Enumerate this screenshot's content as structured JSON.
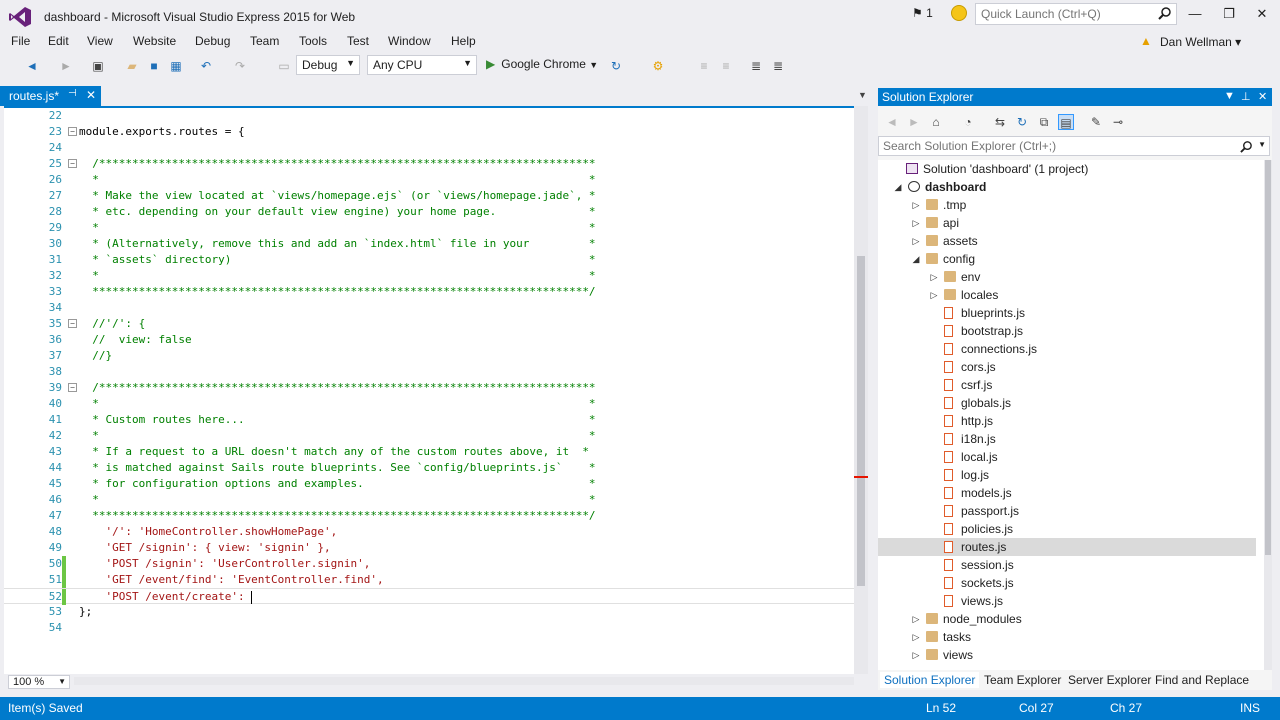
{
  "window": {
    "title": "dashboard - Microsoft Visual Studio Express 2015 for Web",
    "notification_count": "1",
    "quick_launch_placeholder": "Quick Launch (Ctrl+Q)",
    "controls": {
      "minimize": "—",
      "restore": "❐",
      "close": "✕"
    }
  },
  "menu": {
    "items": [
      "File",
      "Edit",
      "View",
      "Website",
      "Debug",
      "Team",
      "Tools",
      "Test",
      "Window",
      "Help"
    ],
    "user": "Dan Wellman"
  },
  "toolbar": {
    "config": "Debug",
    "platform": "Any CPU",
    "run_target": "Google Chrome"
  },
  "editor": {
    "tab_label": "routes.js*",
    "zoom": "100 %",
    "lines": [
      {
        "n": "22",
        "t": "",
        "c": "plain"
      },
      {
        "n": "23",
        "t": "module.exports.routes = {",
        "c": "plain",
        "fold": "−"
      },
      {
        "n": "24",
        "t": "",
        "c": "plain"
      },
      {
        "n": "25",
        "t": "  /***************************************************************************",
        "c": "comment",
        "fold": "−"
      },
      {
        "n": "26",
        "t": "  *                                                                          *",
        "c": "comment"
      },
      {
        "n": "27",
        "t": "  * Make the view located at `views/homepage.ejs` (or `views/homepage.jade`, *",
        "c": "comment"
      },
      {
        "n": "28",
        "t": "  * etc. depending on your default view engine) your home page.              *",
        "c": "comment"
      },
      {
        "n": "29",
        "t": "  *                                                                          *",
        "c": "comment"
      },
      {
        "n": "30",
        "t": "  * (Alternatively, remove this and add an `index.html` file in your         *",
        "c": "comment"
      },
      {
        "n": "31",
        "t": "  * `assets` directory)                                                      *",
        "c": "comment"
      },
      {
        "n": "32",
        "t": "  *                                                                          *",
        "c": "comment"
      },
      {
        "n": "33",
        "t": "  ***************************************************************************/",
        "c": "comment"
      },
      {
        "n": "34",
        "t": "",
        "c": "plain"
      },
      {
        "n": "35",
        "t": "  //'/': {",
        "c": "comment",
        "fold": "−"
      },
      {
        "n": "36",
        "t": "  //  view: false",
        "c": "comment"
      },
      {
        "n": "37",
        "t": "  //}",
        "c": "comment"
      },
      {
        "n": "38",
        "t": "",
        "c": "plain"
      },
      {
        "n": "39",
        "t": "  /***************************************************************************",
        "c": "comment",
        "fold": "−"
      },
      {
        "n": "40",
        "t": "  *                                                                          *",
        "c": "comment"
      },
      {
        "n": "41",
        "t": "  * Custom routes here...                                                    *",
        "c": "comment"
      },
      {
        "n": "42",
        "t": "  *                                                                          *",
        "c": "comment"
      },
      {
        "n": "43",
        "t": "  * If a request to a URL doesn't match any of the custom routes above, it  *",
        "c": "comment"
      },
      {
        "n": "44",
        "t": "  * is matched against Sails route blueprints. See `config/blueprints.js`    *",
        "c": "comment"
      },
      {
        "n": "45",
        "t": "  * for configuration options and examples.                                  *",
        "c": "comment"
      },
      {
        "n": "46",
        "t": "  *                                                                          *",
        "c": "comment"
      },
      {
        "n": "47",
        "t": "  ***************************************************************************/",
        "c": "comment"
      },
      {
        "n": "48",
        "t": "    '/': 'HomeController.showHomePage',",
        "c": "string"
      },
      {
        "n": "49",
        "t": "    'GET /signin': { view: 'signin' },",
        "c": "string"
      },
      {
        "n": "50",
        "t": "    'POST /signin': 'UserController.signin',",
        "c": "string",
        "changed": true
      },
      {
        "n": "51",
        "t": "    'GET /event/find': 'EventController.find',",
        "c": "string",
        "changed": true
      },
      {
        "n": "52",
        "t": "    'POST /event/create': ",
        "c": "string",
        "changed": true,
        "current": true
      },
      {
        "n": "53",
        "t": "};",
        "c": "plain"
      },
      {
        "n": "54",
        "t": "",
        "c": "plain"
      }
    ]
  },
  "solution_explorer": {
    "title": "Solution Explorer",
    "search_placeholder": "Search Solution Explorer (Ctrl+;)",
    "tree": [
      {
        "label": "Solution 'dashboard' (1 project)",
        "depth": 0,
        "type": "solution",
        "tw": ""
      },
      {
        "label": "dashboard",
        "depth": 1,
        "type": "project",
        "tw": "◢",
        "bold": true
      },
      {
        "label": ".tmp",
        "depth": 2,
        "type": "folder",
        "tw": "▷"
      },
      {
        "label": "api",
        "depth": 2,
        "type": "folder",
        "tw": "▷"
      },
      {
        "label": "assets",
        "depth": 2,
        "type": "folder",
        "tw": "▷"
      },
      {
        "label": "config",
        "depth": 2,
        "type": "folder-open",
        "tw": "◢"
      },
      {
        "label": "env",
        "depth": 3,
        "type": "folder",
        "tw": "▷"
      },
      {
        "label": "locales",
        "depth": 3,
        "type": "folder",
        "tw": "▷"
      },
      {
        "label": "blueprints.js",
        "depth": 3,
        "type": "js",
        "tw": ""
      },
      {
        "label": "bootstrap.js",
        "depth": 3,
        "type": "js",
        "tw": ""
      },
      {
        "label": "connections.js",
        "depth": 3,
        "type": "js",
        "tw": ""
      },
      {
        "label": "cors.js",
        "depth": 3,
        "type": "js",
        "tw": ""
      },
      {
        "label": "csrf.js",
        "depth": 3,
        "type": "js",
        "tw": ""
      },
      {
        "label": "globals.js",
        "depth": 3,
        "type": "js",
        "tw": ""
      },
      {
        "label": "http.js",
        "depth": 3,
        "type": "js",
        "tw": ""
      },
      {
        "label": "i18n.js",
        "depth": 3,
        "type": "js",
        "tw": ""
      },
      {
        "label": "local.js",
        "depth": 3,
        "type": "js",
        "tw": ""
      },
      {
        "label": "log.js",
        "depth": 3,
        "type": "js",
        "tw": ""
      },
      {
        "label": "models.js",
        "depth": 3,
        "type": "js",
        "tw": ""
      },
      {
        "label": "passport.js",
        "depth": 3,
        "type": "js",
        "tw": ""
      },
      {
        "label": "policies.js",
        "depth": 3,
        "type": "js",
        "tw": ""
      },
      {
        "label": "routes.js",
        "depth": 3,
        "type": "js",
        "tw": "",
        "selected": true
      },
      {
        "label": "session.js",
        "depth": 3,
        "type": "js",
        "tw": ""
      },
      {
        "label": "sockets.js",
        "depth": 3,
        "type": "js",
        "tw": ""
      },
      {
        "label": "views.js",
        "depth": 3,
        "type": "js",
        "tw": ""
      },
      {
        "label": "node_modules",
        "depth": 2,
        "type": "folder",
        "tw": "▷"
      },
      {
        "label": "tasks",
        "depth": 2,
        "type": "folder",
        "tw": "▷"
      },
      {
        "label": "views",
        "depth": 2,
        "type": "folder",
        "tw": "▷"
      }
    ],
    "tabs": [
      "Solution Explorer",
      "Team Explorer",
      "Server Explorer",
      "Find and Replace"
    ]
  },
  "status": {
    "message": "Item(s) Saved",
    "line": "Ln 52",
    "col": "Col 27",
    "ch": "Ch 27",
    "mode": "INS"
  },
  "colors": {
    "accent": "#007acc",
    "comment": "#008000",
    "string": "#a31515",
    "line_number": "#2b91af"
  }
}
